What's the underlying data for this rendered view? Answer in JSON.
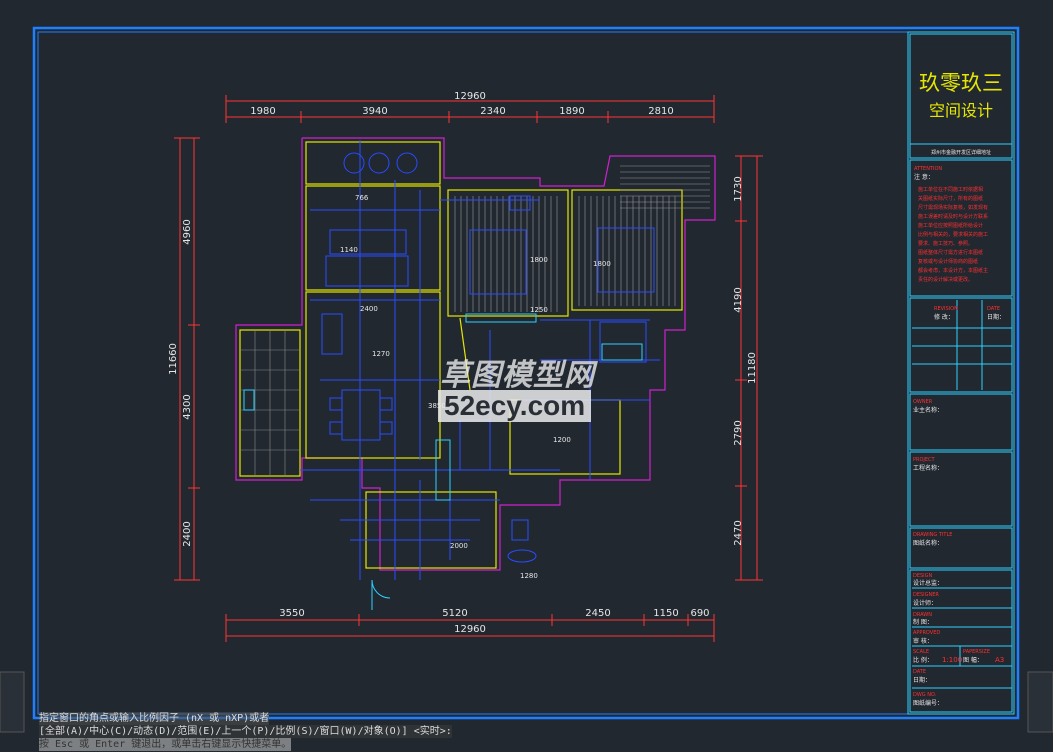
{
  "dimensions": {
    "top_total": "12960",
    "top_segments": [
      "1980",
      "3940",
      "2340",
      "1890",
      "2810"
    ],
    "bottom_total": "12960",
    "bottom_segments": [
      "3550",
      "5120",
      "2450",
      "1150",
      "690"
    ],
    "left_total": "11660",
    "left_segments": [
      "4960",
      "4300",
      "2400"
    ],
    "right_total": "11180",
    "right_segments": [
      "1730",
      "4190",
      "2790",
      "2470"
    ]
  },
  "rooms": {
    "labels": [
      "766",
      "1140",
      "2400",
      "1270",
      "3850",
      "1200",
      "2000",
      "1280",
      "1800",
      "1800",
      "1250"
    ]
  },
  "title_block": {
    "company_line1": "玖零玖三",
    "company_line2": "空间设计",
    "address": "郑州市金融开发区详细地址",
    "attention_title": "ATTENTION",
    "attention_label": "注 意：",
    "attention_lines": [
      "施工单位在不同施工时依据相",
      "关图纸实际尺寸，所有的图纸",
      "尺寸需现场实际复核，如发现有",
      "施工误差时请及时与设计方联系",
      "施工单位应按照图纸所给设计",
      "比例与相关的，要求相关的施工",
      "要求、施工技巧、参照。",
      "图纸整体尺寸需方进行本图纸",
      "复核或与设计师协商的图纸",
      "都会考虑，本设计方，本图纸主",
      "责任的设计解决或更改。"
    ],
    "revision_title": "REVISION",
    "revision_label": "修 改：",
    "date_title": "DATE",
    "date_label": "日期：",
    "owner_title": "OWNER",
    "owner_label": "业主名称：",
    "project_title": "PROJECT",
    "project_label": "工程名称：",
    "drawing_title_en": "DRAWING TITLE",
    "drawing_title_label": "图纸名称：",
    "designer_title": "DESIGN",
    "designer_label": "设计总监：",
    "design2_title": "DESIGNER",
    "design2_label": "设计师：",
    "drawn_title": "DRAWN",
    "drawn_label": "制 图：",
    "approved_title": "APPROVED",
    "approved_label": "审 核：",
    "scale_title": "SCALE",
    "scale_label": "比 例：",
    "scale_value": "1:100",
    "papersize_title": "PAPERSIZE",
    "papersize_label": "图 幅：",
    "papersize_value": "A3",
    "date2_title": "DATE",
    "date2_label": "日期：",
    "dwg_title": "DWG NO.",
    "dwg_label": "图纸编号："
  },
  "watermark": {
    "line1": "草图模型网",
    "line2": "52ecy.com"
  },
  "command_line": {
    "line1": "指定窗口的角点或输入比例因子 (nX 或 nXP)或者",
    "line2": "[全部(A)/中心(C)/动态(D)/范围(E)/上一个(P)/比例(S)/窗口(W)/对象(O)] <实时>:",
    "line3": "按 Esc 或 Enter 键退出，或单击右键显示快捷菜单。"
  },
  "colors": {
    "frame": "#1e7fff",
    "titleblock": "#2fd0ff",
    "dim": "#ff3333",
    "wall": "#e6e600",
    "outline": "#d020d0",
    "furniture": "#2a4bff",
    "grid": "#e6e6e6"
  }
}
